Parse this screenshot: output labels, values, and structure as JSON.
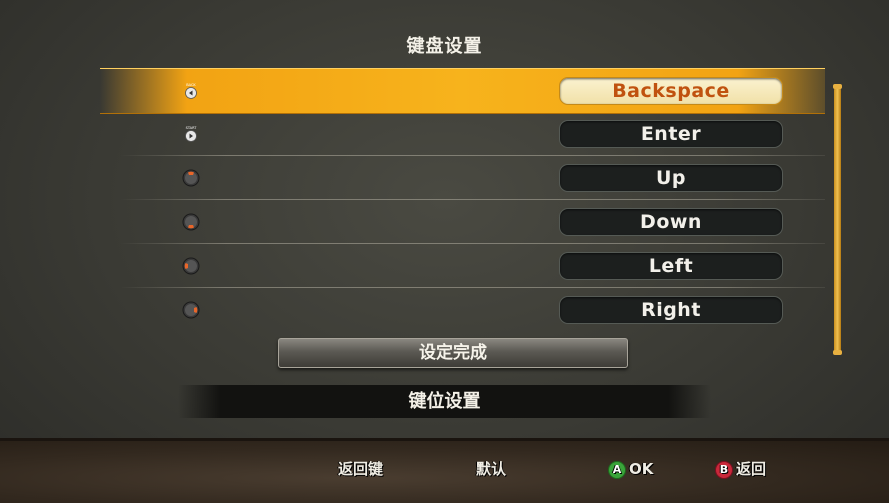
{
  "title": "键盘设置",
  "rows": [
    {
      "icon": "back-button-icon",
      "icon_label": "BACK",
      "key": "Backspace",
      "selected": true
    },
    {
      "icon": "start-button-icon",
      "icon_label": "START",
      "key": "Enter",
      "selected": false
    },
    {
      "icon": "dpad-up-icon",
      "key": "Up",
      "selected": false
    },
    {
      "icon": "dpad-down-icon",
      "key": "Down",
      "selected": false
    },
    {
      "icon": "dpad-left-icon",
      "key": "Left",
      "selected": false
    },
    {
      "icon": "dpad-right-icon",
      "key": "Right",
      "selected": false
    }
  ],
  "done_label": "设定完成",
  "keymap_label": "键位设置",
  "footer": {
    "return_key": "返回键",
    "default": "默认",
    "ok_button": "A",
    "ok_label": "OK",
    "back_button": "B",
    "back_label": "返回"
  },
  "colors": {
    "highlight": "#f7b31c",
    "selected_text": "#c0520f",
    "button_a": "#3aa33a",
    "button_b": "#c8283a",
    "dpad_accent": "#e8662a"
  }
}
